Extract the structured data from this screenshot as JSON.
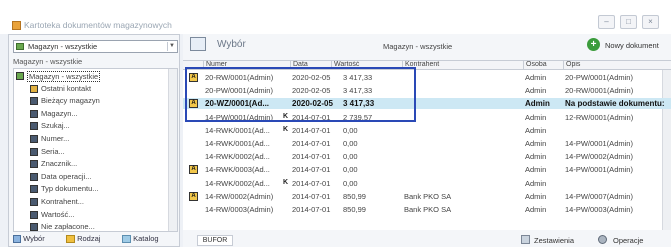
{
  "window": {
    "title": "Kartoteka dokumentów magazynowych",
    "buttons": [
      "minimize-icon",
      "maximize-icon",
      "close-icon"
    ]
  },
  "sidebar": {
    "combo_value": "Magazyn - wszystkie",
    "section_label": "Magazyn - wszystkie",
    "tree": [
      {
        "label": "Magazyn - wszystkie",
        "icon": "folder-icon"
      },
      {
        "label": "Ostatni kontakt",
        "icon": "clock-icon"
      },
      {
        "label": "Bieżący magazyn",
        "icon": "document-icon"
      },
      {
        "label": "Magazyn...",
        "icon": "warehouse-icon"
      },
      {
        "label": "Szukaj...",
        "icon": "search-icon"
      },
      {
        "label": "Numer...",
        "icon": "number-icon"
      },
      {
        "label": "Seria...",
        "icon": "series-icon"
      },
      {
        "label": "Znacznik...",
        "icon": "tag-icon"
      },
      {
        "label": "Data operacji...",
        "icon": "calendar-icon"
      },
      {
        "label": "Typ dokumentu...",
        "icon": "document-type-icon"
      },
      {
        "label": "Kontrahent...",
        "icon": "contractor-icon"
      },
      {
        "label": "Wartość...",
        "icon": "value-icon"
      },
      {
        "label": "Nie zapłacone...",
        "icon": "unpaid-icon"
      }
    ],
    "tabs": [
      "Wybór",
      "Rodzaj",
      "Katalog"
    ]
  },
  "toolbar": {
    "title": "Wybór",
    "filter_label": "Magazyn - wszystkie",
    "new_doc_label": "Nowy dokument"
  },
  "table": {
    "columns": [
      "Numer",
      "Data",
      "Wartość",
      "Kontrahent",
      "Osoba",
      "Opis"
    ],
    "rows": [
      {
        "badge": "A",
        "k": "",
        "numer": "20-RW/0001(Admin)",
        "data": "2020-02-05",
        "wartosc": "3 417,33",
        "kontrahent": "",
        "osoba": "Admin",
        "opis": "20-PW/0001(Admin)",
        "selected": false
      },
      {
        "badge": "",
        "k": "",
        "numer": "20-PW/0001(Admin)",
        "data": "2020-02-05",
        "wartosc": "3 417,33",
        "kontrahent": "",
        "osoba": "Admin",
        "opis": "20-RW/0001(Admin)",
        "selected": false
      },
      {
        "badge": "A",
        "k": "",
        "numer": "20-WZ/0001(Ad...",
        "data": "2020-02-05",
        "wartosc": "3 417,33",
        "kontrahent": "",
        "osoba": "Admin",
        "opis": "Na podstawie dokumentu:",
        "selected": true
      },
      {
        "badge": "",
        "k": "K",
        "numer": "14-PW/0001(Admin)",
        "data": "2014-07-01",
        "wartosc": "2 739,57",
        "kontrahent": "",
        "osoba": "Admin",
        "opis": "12-RW/0001(Admin)",
        "selected": false
      },
      {
        "badge": "",
        "k": "K",
        "numer": "14-RWK/0001(Ad...",
        "data": "2014-07-01",
        "wartosc": "0,00",
        "kontrahent": "",
        "osoba": "Admin",
        "opis": "",
        "selected": false
      },
      {
        "badge": "",
        "k": "",
        "numer": "14-RWK/0001(Ad...",
        "data": "2014-07-01",
        "wartosc": "0,00",
        "kontrahent": "",
        "osoba": "Admin",
        "opis": "14-PW/0001(Admin)",
        "selected": false
      },
      {
        "badge": "",
        "k": "",
        "numer": "14-RWK/0002(Ad...",
        "data": "2014-07-01",
        "wartosc": "0,00",
        "kontrahent": "",
        "osoba": "Admin",
        "opis": "14-PW/0002(Admin)",
        "selected": false
      },
      {
        "badge": "A",
        "k": "",
        "numer": "14-RWK/0003(Ad...",
        "data": "2014-07-01",
        "wartosc": "0,00",
        "kontrahent": "",
        "osoba": "Admin",
        "opis": "14-PW/0001(Admin)",
        "selected": false
      },
      {
        "badge": "",
        "k": "K",
        "numer": "14-RWK/0002(Ad...",
        "data": "2014-07-01",
        "wartosc": "0,00",
        "kontrahent": "",
        "osoba": "Admin",
        "opis": "",
        "selected": false
      },
      {
        "badge": "A",
        "k": "",
        "numer": "14-RW/0002(Admin)",
        "data": "2014-07-01",
        "wartosc": "850,99",
        "kontrahent": "Bank PKO SA",
        "osoba": "Admin",
        "opis": "14-PW/0007(Admin)",
        "selected": false
      },
      {
        "badge": "",
        "k": "",
        "numer": "14-RW/0003(Admin)",
        "data": "2014-07-01",
        "wartosc": "850,99",
        "kontrahent": "Bank PKO SA",
        "osoba": "Admin",
        "opis": "14-PW/0003(Admin)",
        "selected": false
      }
    ]
  },
  "status": {
    "bufor": "BUFOR",
    "zestawienia": "Zestawienia",
    "operacje": "Operacje"
  },
  "colors": {
    "highlight_border": "#2a49b6",
    "selected_row": "#cde8f4",
    "badge": "#f2c74a"
  }
}
